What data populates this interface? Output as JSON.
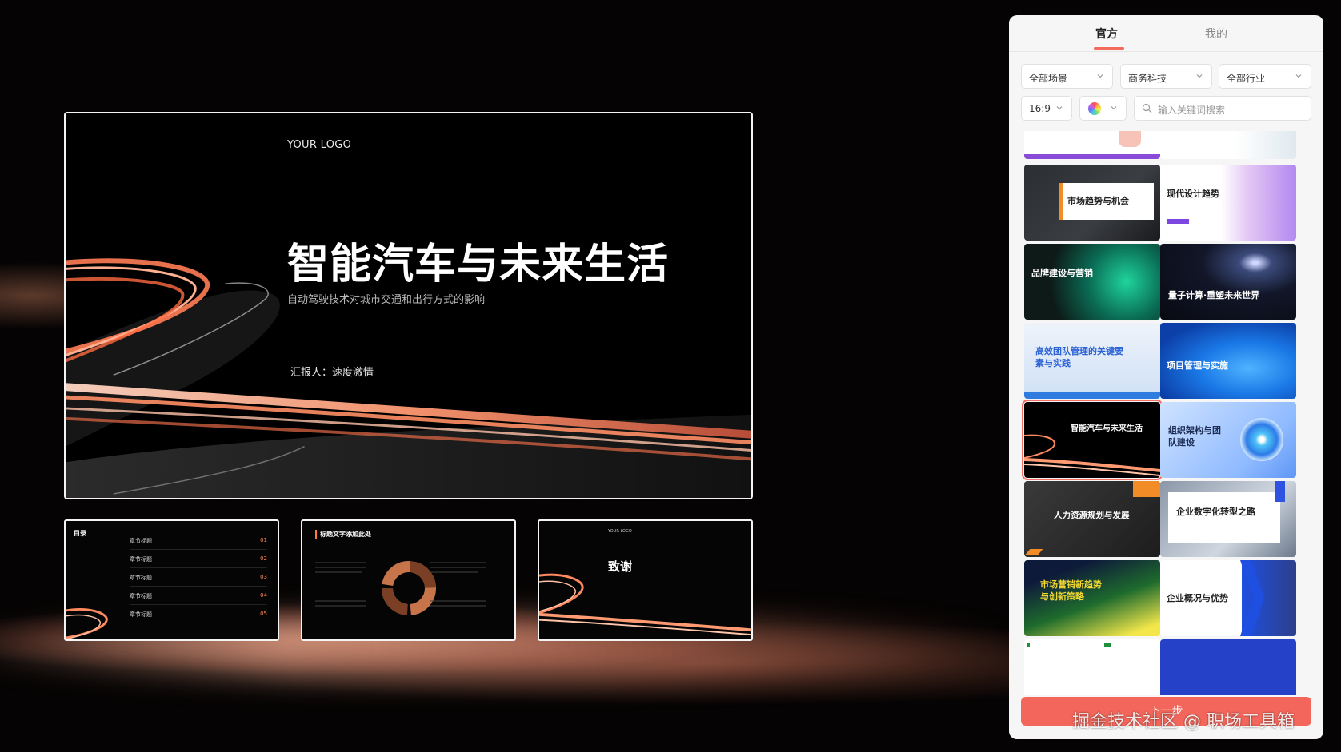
{
  "main_slide": {
    "logo": "YOUR LOGO",
    "title": "智能汽车与未来生活",
    "subtitle": "自动驾驶技术对城市交通和出行方式的影响",
    "reporter": "汇报人：速度激情"
  },
  "thumbnails": {
    "toc": {
      "title": "目录",
      "rows": [
        {
          "label": "章节标题",
          "num": "01"
        },
        {
          "label": "章节标题",
          "num": "02"
        },
        {
          "label": "章节标题",
          "num": "03"
        },
        {
          "label": "章节标题",
          "num": "04"
        },
        {
          "label": "章节标题",
          "num": "05"
        }
      ]
    },
    "chart": {
      "title": "标题文字添加此处"
    },
    "thanks": {
      "logo": "YOUR LOGO",
      "title": "致谢"
    }
  },
  "panel": {
    "tabs": [
      {
        "label": "官方",
        "active": true
      },
      {
        "label": "我的",
        "active": false
      }
    ],
    "filters": {
      "scene": "全部场景",
      "style": "商务科技",
      "industry": "全部行业",
      "ratio": "16:9"
    },
    "search": {
      "placeholder": "输入关键词搜索"
    },
    "templates": [
      {
        "title": "市场趋势与机会"
      },
      {
        "title": "现代设计趋势"
      },
      {
        "title": "品牌建设与营销"
      },
      {
        "title": "量子计算·重塑未来世界"
      },
      {
        "title": "高效团队管理的关键要素与实践"
      },
      {
        "title": "项目管理与实施"
      },
      {
        "title": "智能汽车与未来生活",
        "selected": true
      },
      {
        "title": "组织架构与团队建设"
      },
      {
        "title": "人力资源规划与发展"
      },
      {
        "title": "企业数字化转型之路"
      },
      {
        "title": "市场营销新趋势与创新策略"
      },
      {
        "title": "企业概况与优势"
      }
    ],
    "primary_button": "下一步"
  },
  "watermark": "掘金技术社区 @ 职场工具箱",
  "colors": {
    "accent": "#f2665b",
    "streak": "#ff8a5c",
    "panel_bg": "#f6f6f7"
  }
}
